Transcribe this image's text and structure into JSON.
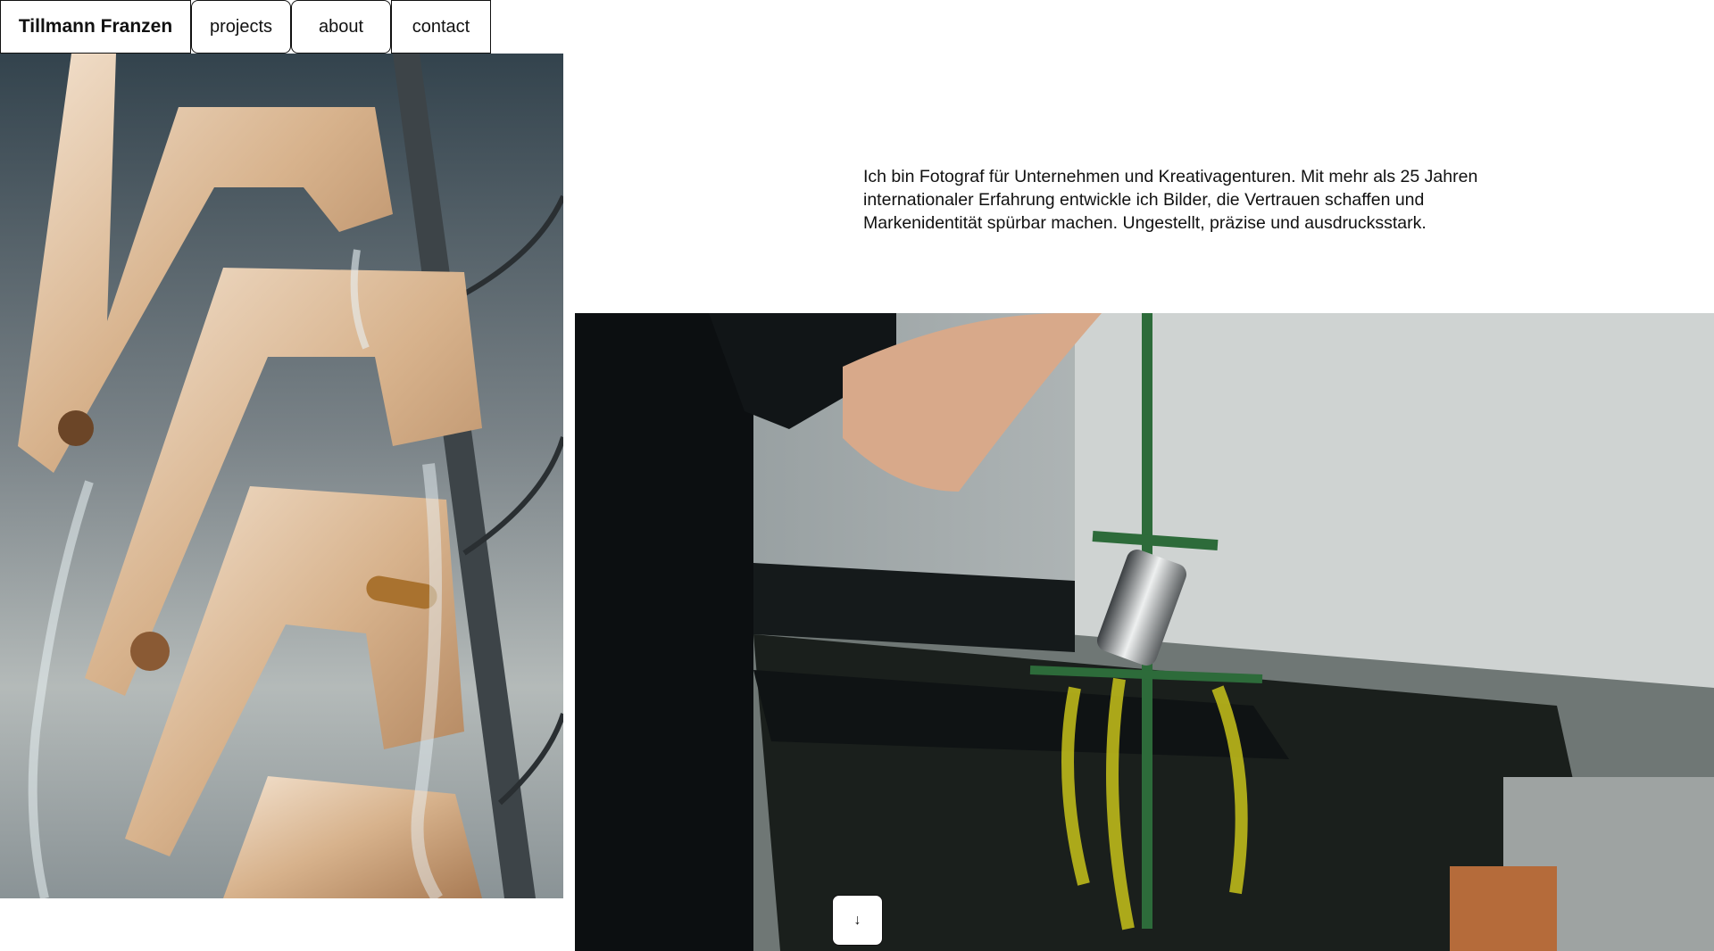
{
  "header": {
    "brand": "Tillmann Franzen",
    "nav": [
      {
        "label": "projects"
      },
      {
        "label": "about"
      },
      {
        "label": "contact"
      }
    ]
  },
  "intro": {
    "text": "Ich bin Fotograf für Unternehmen und Kreativagenturen. Mit mehr als 25 Jahren internationaler Erfahrung entwickle ich Bilder, die Vertrauen schaffen und Markenidentität spürbar machen. Ungestellt, präzise und ausdrucksstark."
  },
  "images": {
    "left_photo": "faucet-handles-photo",
    "right_photo": "electroplating-photo"
  },
  "scroll_button": {
    "icon": "arrow-down-icon",
    "glyph": "↓"
  },
  "colors": {
    "text": "#111111",
    "background": "#ffffff",
    "brass": "#d9b896",
    "plating_liquid": "#c7c21a"
  }
}
